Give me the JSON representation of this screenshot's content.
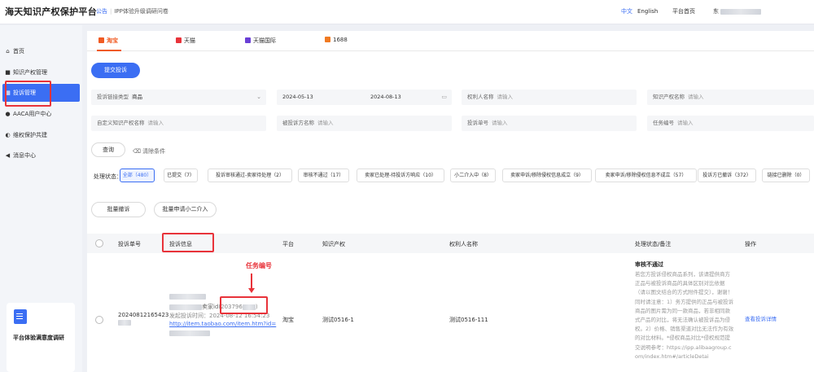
{
  "header": {
    "brand": "海天知识产权保护平台",
    "notice_tag": "公告",
    "notice_sep": "|",
    "notice_text": "IPP体验升级调研问卷",
    "lang_zh": "中文",
    "lang_en": "English",
    "home": "平台首页",
    "user_prefix": "东"
  },
  "sidebar": {
    "items": [
      {
        "label": "首页",
        "icon": "home-icon"
      },
      {
        "label": "知识产权管理",
        "icon": "book-icon"
      },
      {
        "label": "投诉管理",
        "icon": "grid-icon"
      },
      {
        "label": "AACA用户中心",
        "icon": "user-icon"
      },
      {
        "label": "维权保护共建",
        "icon": "globe-icon"
      },
      {
        "label": "消息中心",
        "icon": "bell-icon"
      }
    ],
    "promo_title": "平台体验满意度调研"
  },
  "tabs": [
    {
      "label": "淘宝",
      "color": "#f05a22"
    },
    {
      "label": "天猫",
      "color": "#e8333a"
    },
    {
      "label": "天猫国际",
      "color": "#6a3fd6"
    },
    {
      "label": "1688",
      "color": "#f07a22"
    }
  ],
  "actions": {
    "submit": "提交投诉",
    "query": "查询",
    "clear": "清除条件",
    "batch_withdraw": "批量撤诉",
    "batch_apply": "批量申请小二介入"
  },
  "filters": {
    "link_type_label": "投诉链接类型",
    "link_type_value": "商品",
    "date_start": "2024-05-13",
    "date_end": "2024-08-13",
    "holder_label": "权利人名称",
    "ip_name_label": "知识产权名称",
    "custom_ip_label": "自定义知识产权名称",
    "complainant_label": "被投诉方名称",
    "complaint_no_label": "投诉单号",
    "task_no_label": "任务编号",
    "placeholder": "请输入"
  },
  "status": {
    "label": "处理状态：",
    "chips": [
      "全部（480）",
      "已提交（7）",
      "投诉审核通过-卖家待处理（2）",
      "审核不通过（17）",
      "卖家已处理-待投诉方响应（10）",
      "小二介入中（8）",
      "卖家申诉/移除侵权信息成立（9）",
      "卖家申诉/移除侵权信息不成立（57）",
      "投诉方已撤诉（372）",
      "链接已删除（0）"
    ]
  },
  "table": {
    "headers": [
      "投诉单号",
      "投诉信息",
      "平台",
      "知识产权",
      "权利人名称",
      "处理状态/备注",
      "操作"
    ],
    "row": {
      "complaint_no": "20240812165423",
      "info_line1_prefix": "卖家id",
      "info_line1_mid": "(203796",
      "info_line1_suffix": ")",
      "info_line2_prefix": "发起投诉时间：",
      "info_line2_value": "2024-08-12 16:54:23",
      "info_link": "http://item.taobao.com/item.htm?id=",
      "platform": "淘宝",
      "ip": "测试0516-1",
      "holder": "测试0516-111",
      "status_title": "审核不通过",
      "remark": "若您方投诉侵权商品系列，该请提供商方正品与被投诉商品的具体区别对比依据（请以图文结合的方式附件提交），谢谢！同时请注意：1）务方提供的正品与被投诉商品的图片需为同一款商品，若非相同款式产品的对比，将无法确认被投诉品为侵权。2）价格、销售渠道对比无法作为有效的对比材料。*侵权商品对比*侵权规范提交说明参考：https://ipp.alibaagroup.com/index.htm#/articleDetai",
      "action": "查看投诉详情"
    }
  },
  "annotation": "任务编号"
}
